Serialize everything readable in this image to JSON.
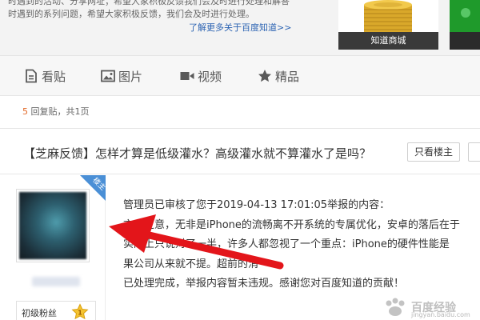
{
  "banner": {
    "notice_line1": "时遇到的活动、分享网址；希望大家积极反馈我们会及时进行处理和解答",
    "notice_line2": "时遇到的系列问题，希望大家积极反馈，我们会及时进行处理。",
    "learn_more": "了解更多关于百度知道>>",
    "shop_label": "知道商城"
  },
  "tabs": [
    {
      "label": "看贴",
      "icon": "doc-icon"
    },
    {
      "label": "图片",
      "icon": "image-icon"
    },
    {
      "label": "视频",
      "icon": "video-icon"
    },
    {
      "label": "精品",
      "icon": "star-icon"
    }
  ],
  "reply": {
    "count": "5",
    "text": " 回复贴，共",
    "pages": "1",
    "page_suffix": "页"
  },
  "thread": {
    "title": "【芝麻反馈】怎样才算是低级灌水？高级灌水就不算灌水了是吗？",
    "only_op_button": "只看楼主",
    "collect_button": ""
  },
  "post": {
    "badge": "楼主",
    "level": "初级粉丝",
    "level_number": "1",
    "lines": [
      "管理员已审核了您于2019-04-13 17:01:05举报的内容：",
      "言下之意，无非是iPhone的流畅离不开系统的专属优化，安卓的落后在于",
      "实际上只说对了一半，许多人都忽视了一个重点：iPhone的硬件性能是",
      "果公司从来就不提。超前的消",
      "已处理完成，举报内容暂未违规。感谢您对百度知道的贡献！"
    ]
  },
  "watermark": {
    "text": "百度经验",
    "url": "jingyan.baidu.com"
  },
  "colors": {
    "link": "#2d64b3",
    "count": "#e26a29",
    "arrow": "#e3151a",
    "badge": "#4a8fd6"
  }
}
